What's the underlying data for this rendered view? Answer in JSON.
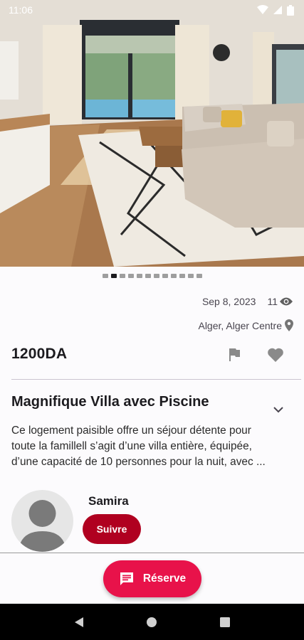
{
  "status_bar": {
    "time": "11:06"
  },
  "gallery": {
    "image": "living-room-photo",
    "dot_count": 12,
    "active_index": 1
  },
  "listing": {
    "date": "Sep 8, 2023",
    "views": "11",
    "location": "Alger, Alger Centre",
    "price": "1200DA",
    "title": "Magnifique Villa avec Piscine",
    "description_lines": [
      "Ce logement paisible offre un séjour détente pour",
      "toute la famillell s’agit d’une villa entière, équipée,",
      "d’une capacité de 10 personnes pour la nuit, avec ..."
    ]
  },
  "host": {
    "name": "Samira",
    "follow_label": "Suivre"
  },
  "actions": {
    "reserve_label": "Réserve"
  },
  "colors": {
    "accent": "#e8124a",
    "follow": "#b00020"
  }
}
